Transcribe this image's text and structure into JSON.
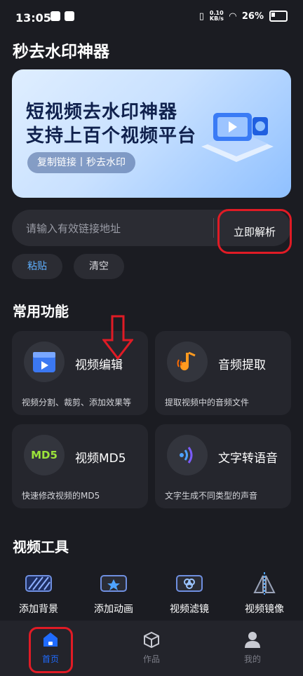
{
  "status_bar": {
    "time": "13:05",
    "net_speed": "0.10\nKB/s",
    "battery": "26%"
  },
  "page_title": "秒去水印神器",
  "banner": {
    "line1": "短视频去水印神器",
    "line2": "支持上百个视频平台",
    "pill": "复制链接丨秒去水印"
  },
  "search": {
    "placeholder": "请输入有效链接地址",
    "value": "",
    "parse_label": "立即解析"
  },
  "chips": {
    "paste": "粘贴",
    "clear": "清空"
  },
  "common": {
    "title": "常用功能",
    "cards": [
      {
        "name": "视频编辑",
        "desc": "视频分割、裁剪、添加效果等",
        "icon": "clapperboard-icon"
      },
      {
        "name": "音频提取",
        "desc": "提取视频中的音频文件",
        "icon": "music-note-icon"
      },
      {
        "name": "视频MD5",
        "desc": "快速修改视频的MD5",
        "icon": "md5-icon",
        "icon_text": "MD5"
      },
      {
        "name": "文字转语音",
        "desc": "文字生成不同类型的声音",
        "icon": "sound-wave-icon"
      }
    ]
  },
  "tools": {
    "title": "视频工具",
    "items": [
      {
        "label": "添加背景",
        "icon": "background-icon"
      },
      {
        "label": "添加动画",
        "icon": "animation-icon"
      },
      {
        "label": "视频滤镜",
        "icon": "filter-icon"
      },
      {
        "label": "视频镜像",
        "icon": "mirror-icon"
      }
    ]
  },
  "nav": [
    {
      "label": "首页",
      "icon": "home-icon",
      "active": true
    },
    {
      "label": "作品",
      "icon": "box-icon",
      "active": false
    },
    {
      "label": "我的",
      "icon": "user-icon",
      "active": false
    }
  ],
  "colors": {
    "accent": "#1f6bff",
    "highlight": "#e01b25",
    "background": "#1b1c22",
    "card": "#25262d"
  }
}
